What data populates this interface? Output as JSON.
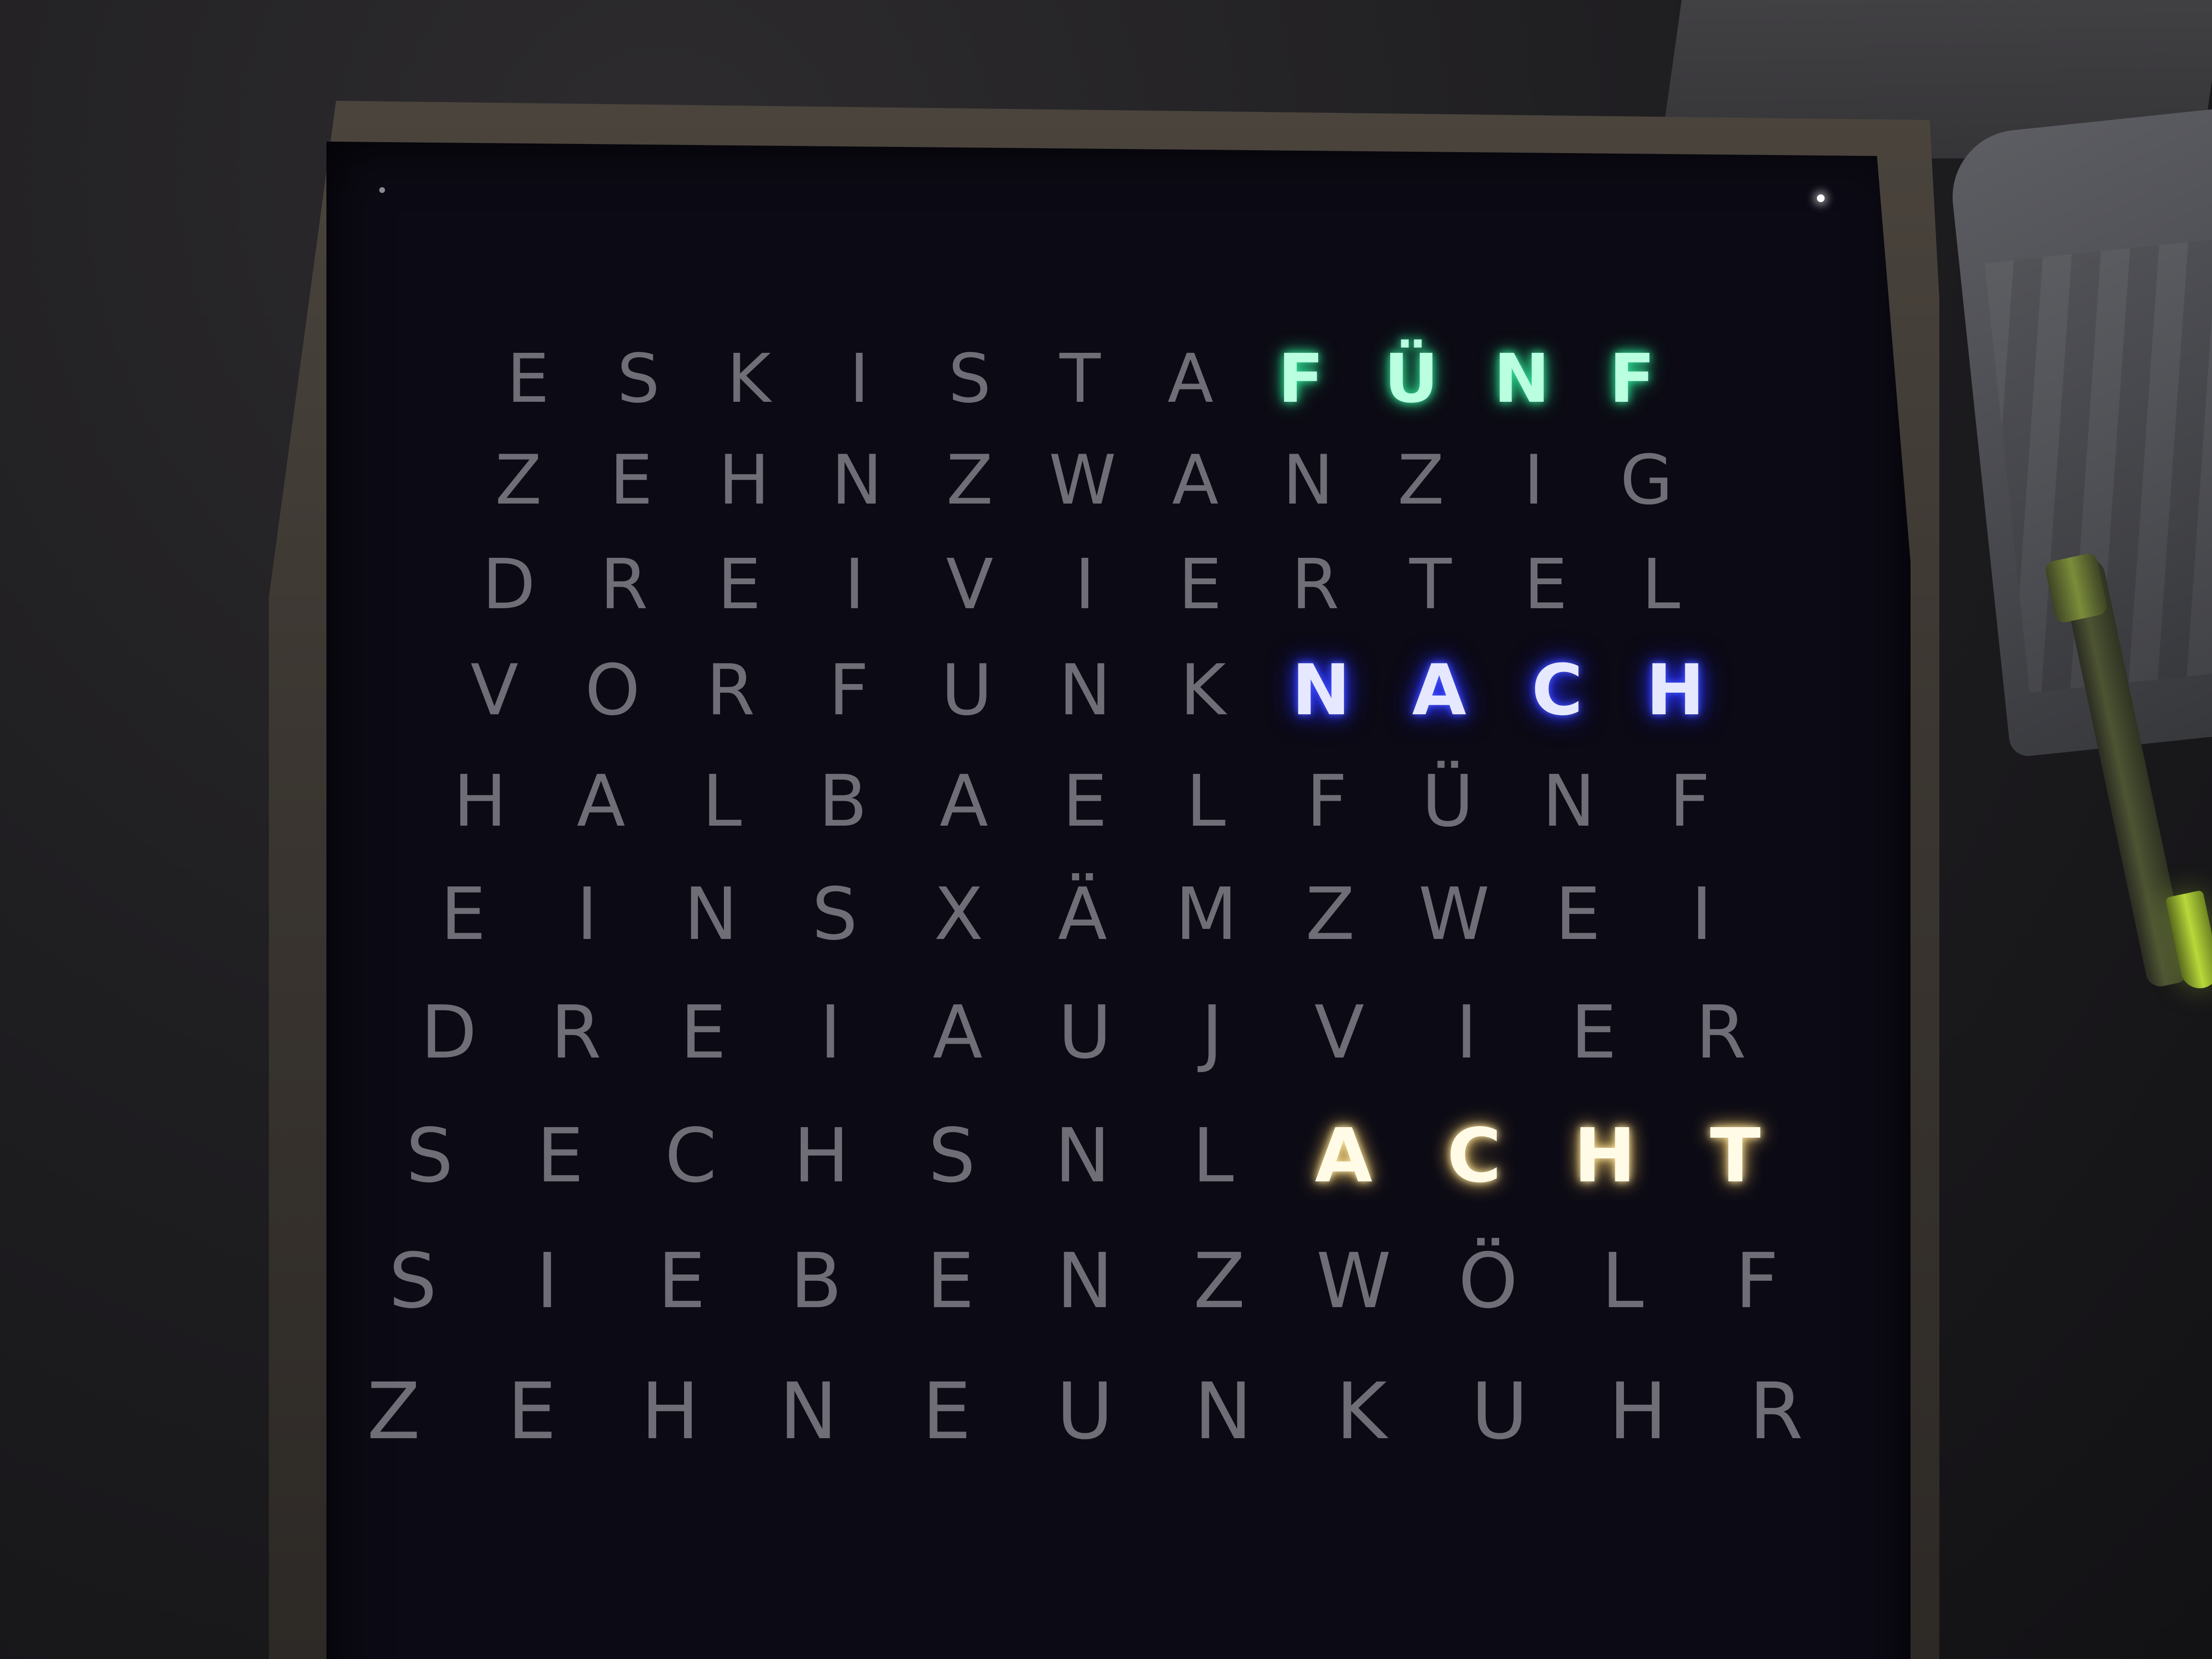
{
  "clock": {
    "rows": [
      {
        "letters": [
          "E",
          "S",
          "K",
          "I",
          "S",
          "T",
          "A",
          "F",
          "Ü",
          "N",
          "F"
        ],
        "lit": [
          false,
          false,
          false,
          false,
          false,
          false,
          false,
          true,
          true,
          true,
          true
        ],
        "lit_color": "green"
      },
      {
        "letters": [
          "Z",
          "E",
          "H",
          "N",
          "Z",
          "W",
          "A",
          "N",
          "Z",
          "I",
          "G"
        ],
        "lit": [
          false,
          false,
          false,
          false,
          false,
          false,
          false,
          false,
          false,
          false,
          false
        ],
        "lit_color": ""
      },
      {
        "letters": [
          "D",
          "R",
          "E",
          "I",
          "V",
          "I",
          "E",
          "R",
          "T",
          "E",
          "L"
        ],
        "lit": [
          false,
          false,
          false,
          false,
          false,
          false,
          false,
          false,
          false,
          false,
          false
        ],
        "lit_color": ""
      },
      {
        "letters": [
          "V",
          "O",
          "R",
          "F",
          "U",
          "N",
          "K",
          "N",
          "A",
          "C",
          "H"
        ],
        "lit": [
          false,
          false,
          false,
          false,
          false,
          false,
          false,
          true,
          true,
          true,
          true
        ],
        "lit_color": "blue"
      },
      {
        "letters": [
          "H",
          "A",
          "L",
          "B",
          "A",
          "E",
          "L",
          "F",
          "Ü",
          "N",
          "F"
        ],
        "lit": [
          false,
          false,
          false,
          false,
          false,
          false,
          false,
          false,
          false,
          false,
          false
        ],
        "lit_color": ""
      },
      {
        "letters": [
          "E",
          "I",
          "N",
          "S",
          "X",
          "Ä",
          "M",
          "Z",
          "W",
          "E",
          "I"
        ],
        "lit": [
          false,
          false,
          false,
          false,
          false,
          false,
          false,
          false,
          false,
          false,
          false
        ],
        "lit_color": ""
      },
      {
        "letters": [
          "D",
          "R",
          "E",
          "I",
          "A",
          "U",
          "J",
          "V",
          "I",
          "E",
          "R"
        ],
        "lit": [
          false,
          false,
          false,
          false,
          false,
          false,
          false,
          false,
          false,
          false,
          false
        ],
        "lit_color": ""
      },
      {
        "letters": [
          "S",
          "E",
          "C",
          "H",
          "S",
          "N",
          "L",
          "A",
          "C",
          "H",
          "T"
        ],
        "lit": [
          false,
          false,
          false,
          false,
          false,
          false,
          false,
          true,
          true,
          true,
          true
        ],
        "lit_color": "warm"
      },
      {
        "letters": [
          "S",
          "I",
          "E",
          "B",
          "E",
          "N",
          "Z",
          "W",
          "Ö",
          "L",
          "F"
        ],
        "lit": [
          false,
          false,
          false,
          false,
          false,
          false,
          false,
          false,
          false,
          false,
          false
        ],
        "lit_color": ""
      },
      {
        "letters": [
          "Z",
          "E",
          "H",
          "N",
          "E",
          "U",
          "N",
          "K",
          "U",
          "H",
          "R"
        ],
        "lit": [
          false,
          false,
          false,
          false,
          false,
          false,
          false,
          false,
          false,
          false,
          false
        ],
        "lit_color": ""
      }
    ],
    "colors": {
      "unlit": "#6f6d75",
      "green": "#37e59a",
      "blue": "#2b36ff",
      "warm": "#ffd36a"
    }
  }
}
